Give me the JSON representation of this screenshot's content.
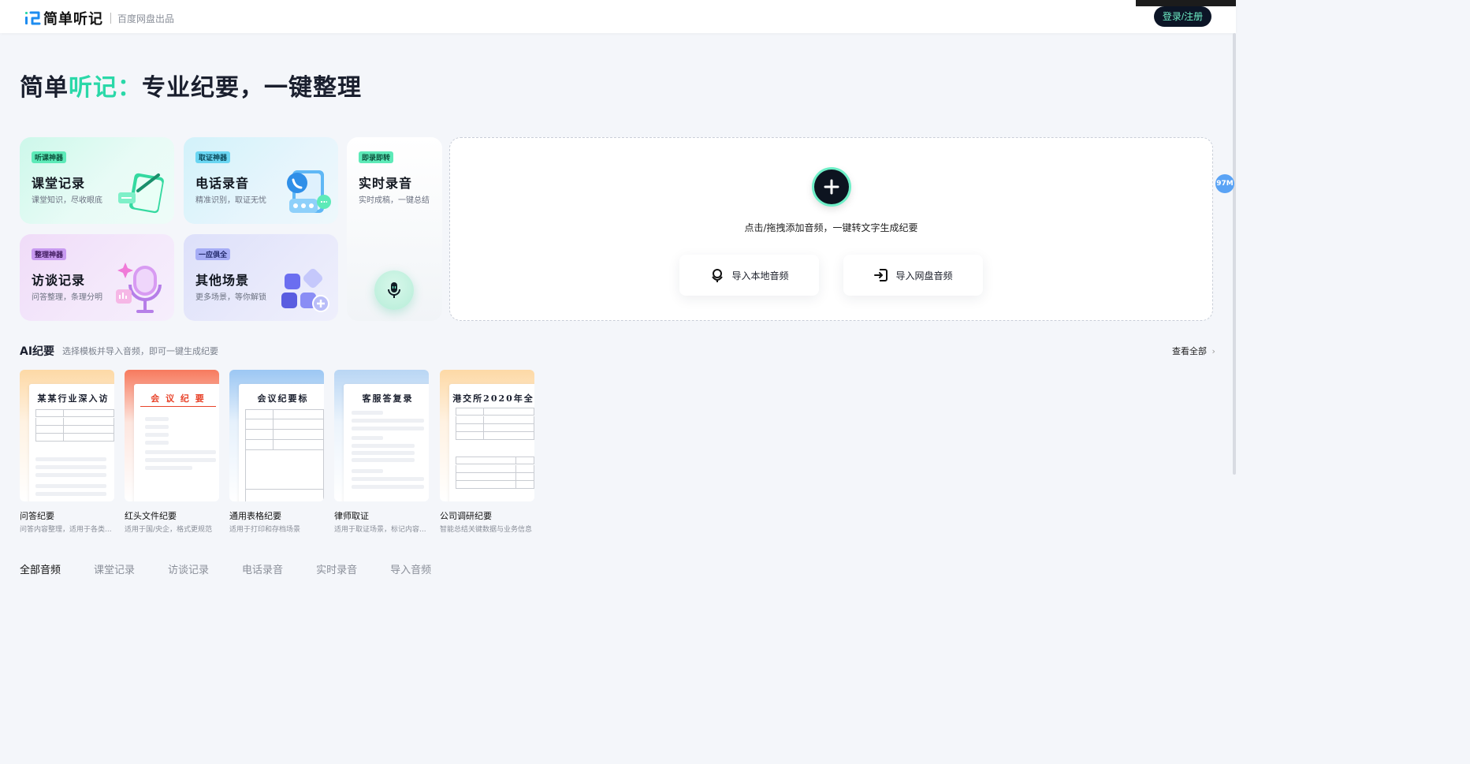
{
  "header": {
    "brand_name": "简单听记",
    "brand_sub": "百度网盘出品",
    "login_label": "登录/注册"
  },
  "side_badge": "97M",
  "hero": {
    "title_part1": "简单",
    "title_accent": "听记：",
    "title_part2": "专业纪要，一键整理"
  },
  "scenarios": [
    {
      "tag": "听课神器",
      "title": "课堂记录",
      "sub": "课堂知识，尽收眼底"
    },
    {
      "tag": "取证神器",
      "title": "电话录音",
      "sub": "精准识别，取证无忧"
    },
    {
      "tag": "即录即转",
      "title": "实时录音",
      "sub": "实时成稿，一键总结"
    },
    {
      "tag": "整理神器",
      "title": "访谈记录",
      "sub": "问答整理，条理分明"
    },
    {
      "tag": "一应俱全",
      "title": "其他场景",
      "sub": "更多场景，等你解锁"
    }
  ],
  "upload": {
    "hint": "点击/拖拽添加音频，一键转文字生成纪要",
    "local_button": "导入本地音频",
    "netdisk_button": "导入网盘音频"
  },
  "ai_section": {
    "title": "AI纪要",
    "subtitle": "选择模板并导入音频，即可一键生成纪要",
    "view_all": "查看全部"
  },
  "templates": [
    {
      "doc_title": "某某行业深入访",
      "name": "问答纪要",
      "desc": "问答内容整理，适用于各类..."
    },
    {
      "doc_title": "会 议 纪 要",
      "name": "红头文件纪要",
      "desc": "适用于国/央企，格式更规范"
    },
    {
      "doc_title": "会议纪要标",
      "name": "通用表格纪要",
      "desc": "适用于打印和存档场景"
    },
    {
      "doc_title": "客服答复录",
      "name": "律师取证",
      "desc": "适用于取证场景，标记内容..."
    },
    {
      "doc_title": "港交所2020年全",
      "name": "公司调研纪要",
      "desc": "智能总结关键数据与业务信息"
    }
  ],
  "tabs": [
    "全部音频",
    "课堂记录",
    "访谈记录",
    "电话录音",
    "实时录音",
    "导入音频"
  ],
  "colors": {
    "accent": "#2ad8a8",
    "dark": "#0c1526",
    "page_bg": "#f4f6fa"
  }
}
